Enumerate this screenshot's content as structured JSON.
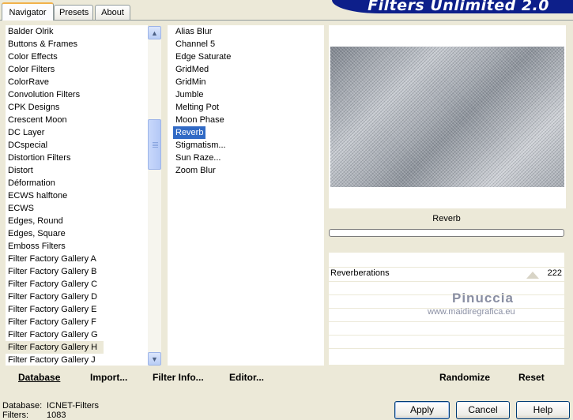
{
  "tabs": [
    {
      "label": "Navigator"
    },
    {
      "label": "Presets"
    },
    {
      "label": "About"
    }
  ],
  "banner": {
    "title": "Filters Unlimited 2.0"
  },
  "categories": [
    "Balder Olrik",
    "Buttons & Frames",
    "Color Effects",
    "Color Filters",
    "ColorRave",
    "Convolution Filters",
    "CPK Designs",
    "Crescent Moon",
    "DC Layer",
    "DCspecial",
    "Distortion Filters",
    "Distort",
    "Déformation",
    "ECWS halftone",
    "ECWS",
    "Edges, Round",
    "Edges, Square",
    "Emboss Filters",
    "Filter Factory Gallery A",
    "Filter Factory Gallery B",
    "Filter Factory Gallery C",
    "Filter Factory Gallery D",
    "Filter Factory Gallery E",
    "Filter Factory Gallery F",
    "Filter Factory Gallery G",
    "Filter Factory Gallery H",
    "Filter Factory Gallery J"
  ],
  "filters": [
    "Alias Blur",
    "Channel 5",
    "Edge Saturate",
    "GridMed",
    "GridMin",
    "Jumble",
    "Melting Pot",
    "Moon Phase",
    "Reverb",
    "Stigmatism...",
    "Sun Raze...",
    "Zoom Blur"
  ],
  "selected_filter_name": "Reverb",
  "parameter": {
    "name": "Reverberations",
    "value": "222"
  },
  "watermark": {
    "name": "Pinuccia",
    "url": "www.maidiregrafica.eu"
  },
  "toolbar": {
    "database": "Database",
    "import": "Import...",
    "filter_info": "Filter Info...",
    "editor": "Editor...",
    "randomize": "Randomize",
    "reset": "Reset"
  },
  "status": {
    "database_label": "Database:",
    "database_value": "ICNET-Filters",
    "filters_label": "Filters:",
    "filters_value": "1083"
  },
  "buttons": {
    "apply": "Apply",
    "cancel": "Cancel",
    "help": "Help"
  },
  "colors": {
    "selection_blue": "#316ac5",
    "banner_blue": "#0d1f8a",
    "dialog_bg": "#ece9d8"
  }
}
